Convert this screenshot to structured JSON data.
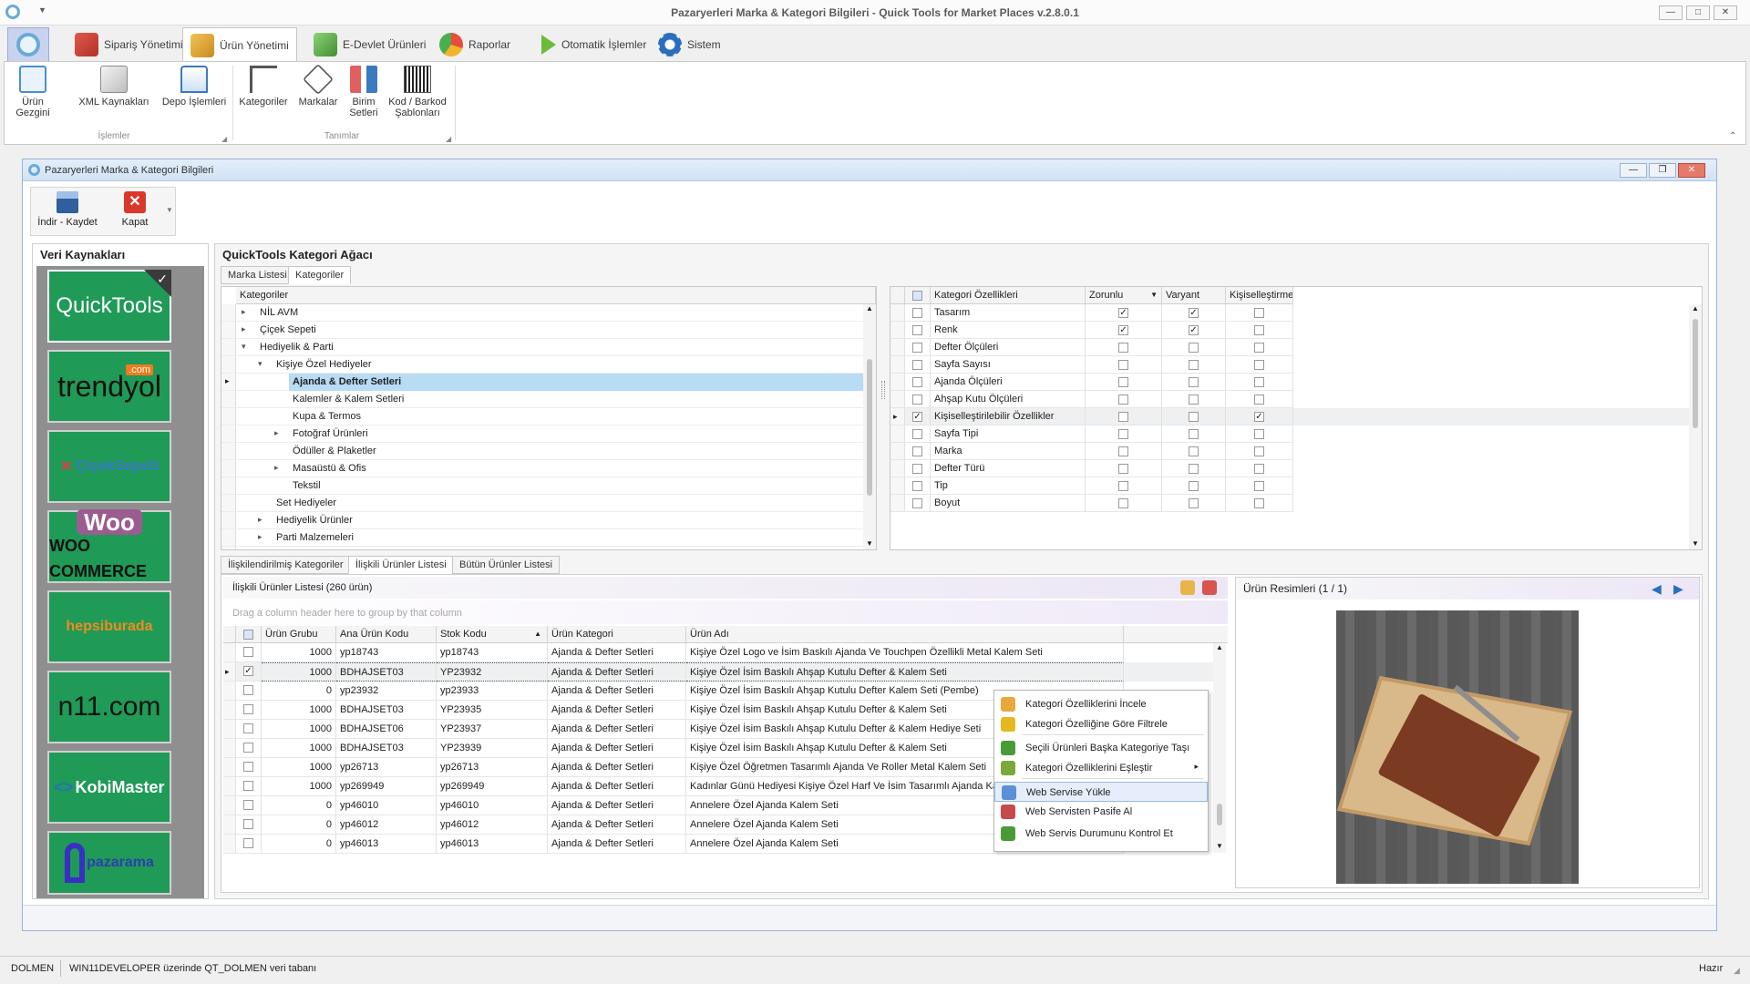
{
  "app": {
    "title": "Pazaryerleri Marka & Kategori Bilgileri - Quick Tools for Market Places v.2.8.0.1",
    "colors": {
      "accent": "#2a6fbe",
      "highlight": "#b7dcf3"
    }
  },
  "ribbon_tabs": [
    {
      "label": "Sipariş Yönetimi",
      "icon": "cart-icon"
    },
    {
      "label": "Ürün Yönetimi",
      "icon": "boxes-icon"
    },
    {
      "label": "E-Devlet Ürünleri",
      "icon": "shield-check-icon"
    },
    {
      "label": "Raporlar",
      "icon": "pie-chart-icon"
    },
    {
      "label": "Otomatik İşlemler",
      "icon": "play-icon"
    },
    {
      "label": "Sistem",
      "icon": "gear-icon"
    }
  ],
  "ribbon": {
    "group1": {
      "label": "İşlemler",
      "buttons": [
        "Ürün Gezgini",
        "XML Kaynakları",
        "Depo İşlemleri"
      ]
    },
    "group2": {
      "label": "Tanımlar",
      "buttons": [
        "Kategoriler",
        "Markalar",
        "Birim\nSetleri",
        "Kod / Barkod\nŞablonları"
      ]
    }
  },
  "child": {
    "title": "Pazaryerleri Marka & Kategori Bilgileri",
    "toolbar": {
      "save": "İndir - Kaydet",
      "close": "Kapat"
    }
  },
  "sources": {
    "title": "Veri Kaynakları",
    "items": [
      "QuickTools",
      "trendyol",
      "ÇiçekSepeti",
      "WOO COMMERCE",
      "hepsiburada",
      "n11.com",
      "KobiMaster",
      "pazarama"
    ],
    "trendyol_badge": ".com"
  },
  "tree": {
    "title": "QuickTools Kategori Ağacı",
    "tabs": [
      "Marka Listesi",
      "Kategoriler"
    ],
    "header": "Kategoriler",
    "rows": [
      {
        "label": "NİL AVM",
        "indent": 0,
        "exp": "▸"
      },
      {
        "label": "Çiçek Sepeti",
        "indent": 0,
        "exp": "▸"
      },
      {
        "label": "Hediyelik & Parti",
        "indent": 0,
        "exp": "▾"
      },
      {
        "label": "Kişiye Özel Hediyeler",
        "indent": 1,
        "exp": "▾"
      },
      {
        "label": "Ajanda & Defter Setleri",
        "indent": 2,
        "exp": "",
        "sel": true
      },
      {
        "label": "Kalemler & Kalem Setleri",
        "indent": 2,
        "exp": ""
      },
      {
        "label": "Kupa & Termos",
        "indent": 2,
        "exp": ""
      },
      {
        "label": "Fotoğraf Ürünleri",
        "indent": 2,
        "exp": "▸"
      },
      {
        "label": "Ödüller & Plaketler",
        "indent": 2,
        "exp": ""
      },
      {
        "label": "Masaüstü & Ofis",
        "indent": 2,
        "exp": "▸"
      },
      {
        "label": "Tekstil",
        "indent": 2,
        "exp": ""
      },
      {
        "label": "Set Hediyeler",
        "indent": 1,
        "exp": ""
      },
      {
        "label": "Hediyelik Ürünler",
        "indent": 1,
        "exp": "▸"
      },
      {
        "label": "Parti Malzemeleri",
        "indent": 1,
        "exp": "▸"
      }
    ]
  },
  "props": {
    "headers": [
      "Kategori Özellikleri",
      "Zorunlu",
      "Varyant",
      "Kişiselleştirme"
    ],
    "rows": [
      {
        "name": "Tasarım",
        "sel": false,
        "z": true,
        "v": true,
        "k": false
      },
      {
        "name": "Renk",
        "sel": false,
        "z": true,
        "v": true,
        "k": false
      },
      {
        "name": "Defter Ölçüleri",
        "sel": false,
        "z": false,
        "v": false,
        "k": false
      },
      {
        "name": "Sayfa Sayısı",
        "sel": false,
        "z": false,
        "v": false,
        "k": false
      },
      {
        "name": "Ajanda Ölçüleri",
        "sel": false,
        "z": false,
        "v": false,
        "k": false
      },
      {
        "name": "Ahşap Kutu Ölçüleri",
        "sel": false,
        "z": false,
        "v": false,
        "k": false
      },
      {
        "name": "Kişiselleştirilebilir Özellikler",
        "sel": true,
        "z": false,
        "v": false,
        "k": true
      },
      {
        "name": "Sayfa Tipi",
        "sel": false,
        "z": false,
        "v": false,
        "k": false
      },
      {
        "name": "Marka",
        "sel": false,
        "z": false,
        "v": false,
        "k": false
      },
      {
        "name": "Defter Türü",
        "sel": false,
        "z": false,
        "v": false,
        "k": false
      },
      {
        "name": "Tip",
        "sel": false,
        "z": false,
        "v": false,
        "k": false
      },
      {
        "name": "Boyut",
        "sel": false,
        "z": false,
        "v": false,
        "k": false
      }
    ]
  },
  "bottom_tabs": [
    "İlişkilendirilmiş Kategoriler",
    "İlişkili Ürünler Listesi",
    "Bütün Ürünler Listesi"
  ],
  "products": {
    "title": "İlişkili Ürünler Listesi (260 ürün)",
    "group_hint": "Drag a column header here to group by that column",
    "headers": [
      "Ürün Grubu",
      "Ana Ürün Kodu",
      "Stok Kodu",
      "Ürün Kategori",
      "Ürün Adı"
    ],
    "rows": [
      {
        "chk": false,
        "g": "1000",
        "a": "yp18743",
        "s": "yp18743",
        "c": "Ajanda & Defter Setleri",
        "n": "Kişiye Özel Logo ve İsim Baskılı  Ajanda Ve Touchpen Özellikli Metal Kalem Seti"
      },
      {
        "chk": true,
        "g": "1000",
        "a": "BDHAJSET03",
        "s": "YP23932",
        "c": "Ajanda & Defter Setleri",
        "n": "Kişiye Özel İsim Baskılı Ahşap Kutulu Defter & Kalem Seti"
      },
      {
        "chk": false,
        "g": "0",
        "a": "yp23932",
        "s": "yp23933",
        "c": "Ajanda & Defter Setleri",
        "n": "Kişiye Özel İsim Baskılı Ahşap Kutulu Defter Kalem Seti (Pembe)"
      },
      {
        "chk": false,
        "g": "1000",
        "a": "BDHAJSET03",
        "s": "YP23935",
        "c": "Ajanda & Defter Setleri",
        "n": "Kişiye Özel İsim Baskılı Ahşap Kutulu Defter & Kalem Seti"
      },
      {
        "chk": false,
        "g": "1000",
        "a": "BDHAJSET06",
        "s": "YP23937",
        "c": "Ajanda & Defter Setleri",
        "n": "Kişiye Özel İsim Baskılı Ahşap Kutulu Defter & Kalem Hediye Seti"
      },
      {
        "chk": false,
        "g": "1000",
        "a": "BDHAJSET03",
        "s": "YP23939",
        "c": "Ajanda & Defter Setleri",
        "n": "Kişiye Özel İsim Baskılı Ahşap Kutulu Defter & Kalem Seti"
      },
      {
        "chk": false,
        "g": "1000",
        "a": "yp26713",
        "s": "yp26713",
        "c": "Ajanda & Defter Setleri",
        "n": "Kişiye Özel Öğretmen Tasarımlı Ajanda Ve Roller Metal Kalem Seti"
      },
      {
        "chk": false,
        "g": "1000",
        "a": "yp269949",
        "s": "yp269949",
        "c": "Ajanda & Defter Setleri",
        "n": "Kadınlar Günü Hediyesi Kişiye Özel Harf Ve İsim Tasarımlı Ajanda Kale"
      },
      {
        "chk": false,
        "g": "0",
        "a": "yp46010",
        "s": "yp46010",
        "c": "Ajanda & Defter Setleri",
        "n": "Annelere Özel Ajanda Kalem Seti"
      },
      {
        "chk": false,
        "g": "0",
        "a": "yp46012",
        "s": "yp46012",
        "c": "Ajanda & Defter Setleri",
        "n": "Annelere Özel Ajanda Kalem Seti"
      },
      {
        "chk": false,
        "g": "0",
        "a": "yp46013",
        "s": "yp46013",
        "c": "Ajanda & Defter Setleri",
        "n": "Annelere Özel Ajanda Kalem Seti"
      }
    ]
  },
  "context_menu": [
    {
      "label": "Kategori Özelliklerini İncele",
      "icon": "inspect-icon",
      "color": "#e8a83c"
    },
    {
      "label": "Kategori Özelliğine Göre Filtrele",
      "icon": "filter-icon",
      "color": "#e3b91e"
    },
    {
      "label": "Seçili Ürünleri Başka Kategoriye Taşı",
      "icon": "move-icon",
      "color": "#4a9a3a"
    },
    {
      "label": "Kategori Özelliklerini Eşleştir",
      "icon": "match-icon",
      "color": "#7aa83a",
      "sub": "▸"
    },
    {
      "label": "Web Servise Yükle",
      "icon": "upload-icon",
      "color": "#5b8fd6"
    },
    {
      "label": "Web Servisten Pasife Al",
      "icon": "disable-icon",
      "color": "#c84a4a"
    },
    {
      "label": "Web Servis Durumunu Kontrol Et",
      "icon": "check-status-icon",
      "color": "#4a9a3a"
    }
  ],
  "images": {
    "title": "Ürün Resimleri (1 / 1)"
  },
  "status": {
    "user": "DOLMEN",
    "db": "WIN11DEVELOPER üzerinde QT_DOLMEN veri tabanı",
    "state": "Hazır"
  }
}
